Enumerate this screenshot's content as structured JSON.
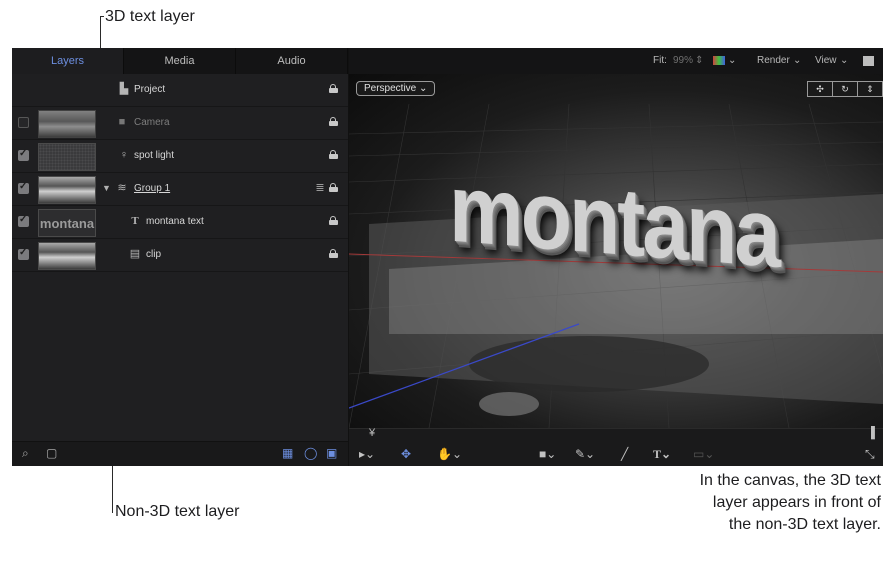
{
  "callouts": {
    "top": "3D text layer",
    "bottom": "Non-3D text layer"
  },
  "caption": {
    "line1": "In the canvas, the 3D text",
    "line2": "layer appears in front of",
    "line3": "the non-3D text layer."
  },
  "tabs": [
    {
      "label": "Layers",
      "active": true
    },
    {
      "label": "Media",
      "active": false
    },
    {
      "label": "Audio",
      "active": false
    }
  ],
  "layers": [
    {
      "label": "Project",
      "icon": "document-icon",
      "checked": null,
      "thumb": null
    },
    {
      "label": "Camera",
      "icon": "camera-icon",
      "checked": false,
      "thumb": "landscape"
    },
    {
      "label": "spot light",
      "icon": "light-bulb-icon",
      "checked": true,
      "thumb": "light"
    },
    {
      "label": "Group 1",
      "icon": "group-icon",
      "checked": true,
      "thumb": "landscape",
      "expanded": true
    },
    {
      "label": "montana text",
      "icon": "text-3d-icon",
      "checked": true,
      "thumb": "montana"
    },
    {
      "label": "clip",
      "icon": "film-icon",
      "checked": true,
      "thumb": "landscape"
    }
  ],
  "thumb_text": "montana",
  "toolbar": {
    "fit_label": "Fit:",
    "fit_value": "99%",
    "render_label": "Render",
    "view_label": "View"
  },
  "canvas": {
    "view_mode": "Perspective",
    "text": "montana"
  },
  "colors": {
    "accent": "#6d8fe0",
    "panel_bg": "#1f1f21",
    "canvas_bg": "#121213"
  }
}
